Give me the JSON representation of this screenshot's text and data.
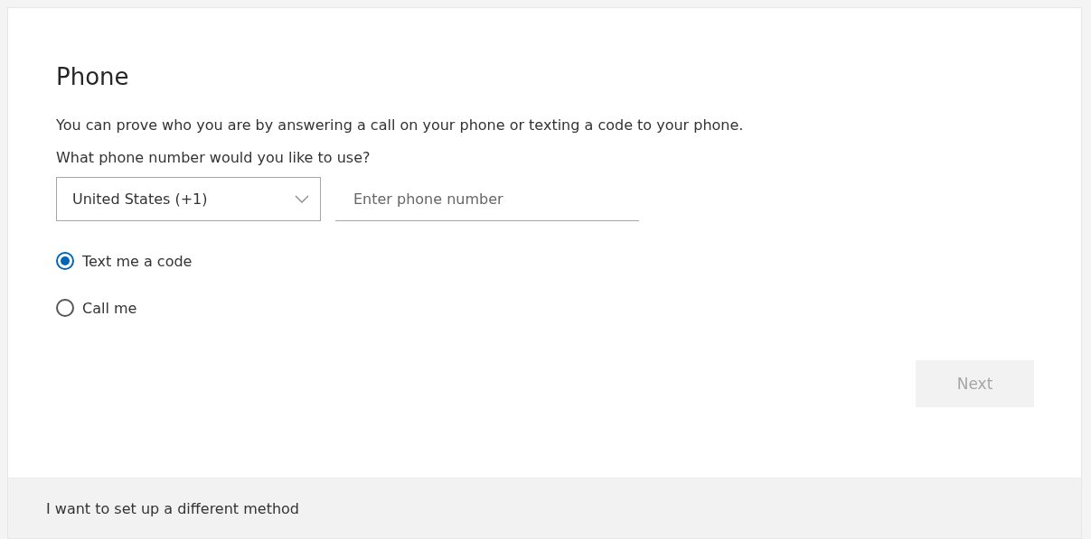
{
  "title": "Phone",
  "description": "You can prove who you are by answering a call on your phone or texting a code to your phone.",
  "question": "What phone number would you like to use?",
  "country_select": {
    "value": "United States (+1)"
  },
  "phone_field": {
    "placeholder": "Enter phone number"
  },
  "options": [
    {
      "label": "Text me a code",
      "selected": true
    },
    {
      "label": "Call me",
      "selected": false
    }
  ],
  "next_button": {
    "label": "Next",
    "disabled": true
  },
  "footer_link": "I want to set up a different method"
}
